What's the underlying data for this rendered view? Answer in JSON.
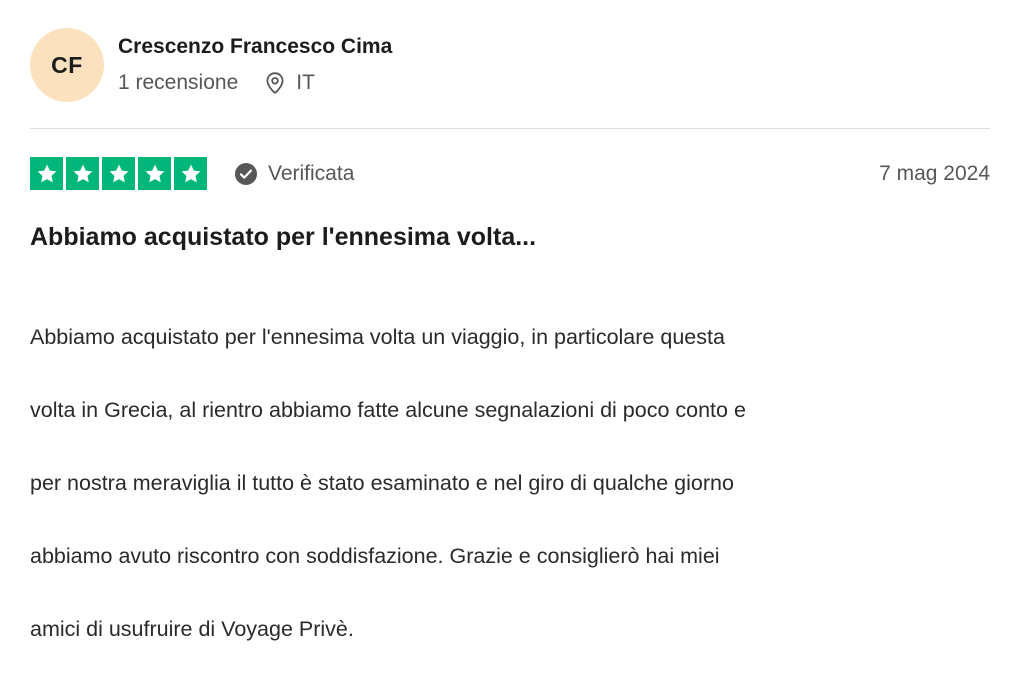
{
  "reviewer": {
    "initials": "CF",
    "name": "Crescenzo Francesco Cima",
    "review_count": "1 recensione",
    "country": "IT",
    "location_icon": "map-pin-icon",
    "avatar_color": "#fbe1bd"
  },
  "review": {
    "rating": 5,
    "max_rating": 5,
    "star_color": "#00b67a",
    "verified_label": "Verificata",
    "verified_icon": "check-circle-icon",
    "date": "7 mag 2024",
    "title": "Abbiamo acquistato per l'ennesima volta...",
    "body_lines": [
      "Abbiamo acquistato per l'ennesima volta un viaggio, in particolare questa",
      "volta in Grecia, al rientro abbiamo fatte alcune segnalazioni di poco conto e",
      "per nostra meraviglia il tutto è stato esaminato e nel giro di qualche giorno",
      "abbiamo avuto riscontro con soddisfazione. Grazie e consiglierò hai miei",
      "amici di usufruire di Voyage Privè."
    ]
  }
}
